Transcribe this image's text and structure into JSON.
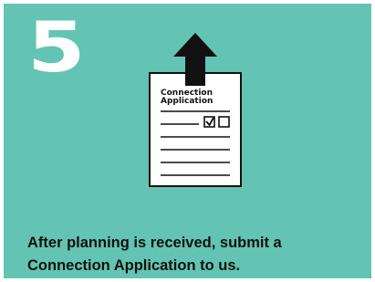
{
  "step": {
    "number": "5",
    "caption_lines": [
      "After planning is received, submit a",
      "Connection Application to us."
    ]
  },
  "document": {
    "title_line1": "Connection",
    "title_line2": "Application",
    "checkbox_checked": true
  },
  "icons": [
    "upload-arrow-icon",
    "application-document-icon",
    "checked-checkbox-icon",
    "empty-checkbox-icon"
  ],
  "colors": {
    "card_background": "#63c4b3",
    "number": "#ffffff",
    "text": "#111111",
    "arrow": "#111111"
  }
}
